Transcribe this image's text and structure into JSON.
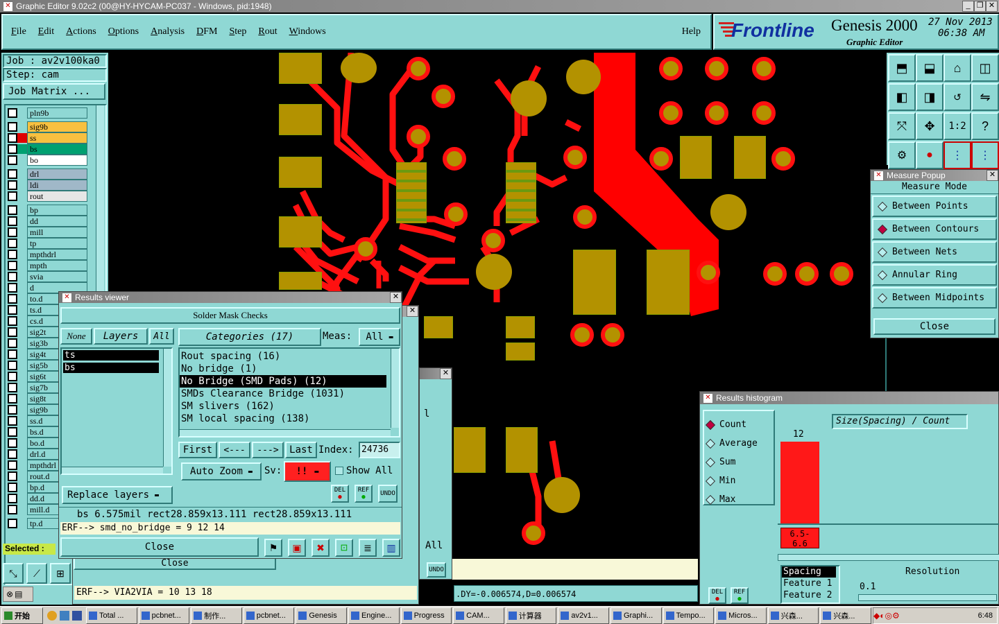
{
  "window": {
    "title": "Graphic Editor 9.02c2 (00@HY-HYCAM-PC037 - Windows, pid:1948)"
  },
  "menu": {
    "items": [
      "File",
      "Edit",
      "Actions",
      "Options",
      "Analysis",
      "DFM",
      "Step",
      "Rout",
      "Windows"
    ],
    "help": "Help"
  },
  "brand": {
    "logo": "Frontline",
    "product": "Genesis 2000",
    "sub": "Graphic Editor",
    "date": "27 Nov 2013",
    "time": "06:38 AM"
  },
  "job": {
    "job_label": "Job  : av2v100ka0",
    "step_label": "Step: cam",
    "matrix_button": "Job Matrix ..."
  },
  "layers": [
    {
      "name": "pln9b",
      "color": "#8fd8d4",
      "sw": "#8fd8d4"
    },
    {
      "name": "sig9b",
      "color": "#f7c040",
      "sw": "#8fd8d4"
    },
    {
      "name": "ss",
      "color": "#f7c040",
      "sw": "#e00000"
    },
    {
      "name": "bs",
      "color": "#00a070",
      "sw": "#00a070"
    },
    {
      "name": "bo",
      "color": "#ffffff",
      "sw": "#8fd8d4"
    },
    {
      "name": "drl",
      "color": "#a0b8c8",
      "sw": "#8fd8d4"
    },
    {
      "name": "ldi",
      "color": "#a0b8c8",
      "sw": "#8fd8d4"
    },
    {
      "name": "rout",
      "color": "#e6e6e6",
      "sw": "#8fd8d4"
    },
    {
      "name": "bp",
      "color": "#8fd8d4",
      "sw": "#8fd8d4"
    },
    {
      "name": "dd",
      "color": "#8fd8d4",
      "sw": "#8fd8d4"
    },
    {
      "name": "mill",
      "color": "#8fd8d4",
      "sw": "#8fd8d4"
    },
    {
      "name": "tp",
      "color": "#8fd8d4",
      "sw": "#8fd8d4"
    },
    {
      "name": "mpthdrl",
      "color": "#8fd8d4",
      "sw": "#8fd8d4"
    },
    {
      "name": "mpth",
      "color": "#8fd8d4",
      "sw": "#8fd8d4"
    },
    {
      "name": "svia",
      "color": "#8fd8d4",
      "sw": "#8fd8d4"
    },
    {
      "name": "d",
      "color": "#8fd8d4",
      "sw": "#8fd8d4"
    },
    {
      "name": "to.d",
      "color": "#8fd8d4",
      "sw": "#8fd8d4"
    },
    {
      "name": "ts.d",
      "color": "#8fd8d4",
      "sw": "#8fd8d4"
    },
    {
      "name": "cs.d",
      "color": "#8fd8d4",
      "sw": "#8fd8d4"
    },
    {
      "name": "sig2t",
      "color": "#8fd8d4",
      "sw": "#8fd8d4"
    },
    {
      "name": "sig3b",
      "color": "#8fd8d4",
      "sw": "#8fd8d4"
    },
    {
      "name": "sig4t",
      "color": "#8fd8d4",
      "sw": "#8fd8d4"
    },
    {
      "name": "sig5b",
      "color": "#8fd8d4",
      "sw": "#8fd8d4"
    },
    {
      "name": "sig6t",
      "color": "#8fd8d4",
      "sw": "#8fd8d4"
    },
    {
      "name": "sig7b",
      "color": "#8fd8d4",
      "sw": "#8fd8d4"
    },
    {
      "name": "sig8t",
      "color": "#8fd8d4",
      "sw": "#8fd8d4"
    },
    {
      "name": "sig9b",
      "color": "#8fd8d4",
      "sw": "#8fd8d4"
    },
    {
      "name": "ss.d",
      "color": "#8fd8d4",
      "sw": "#8fd8d4"
    },
    {
      "name": "bs.d",
      "color": "#8fd8d4",
      "sw": "#8fd8d4"
    },
    {
      "name": "bo.d",
      "color": "#8fd8d4",
      "sw": "#8fd8d4"
    },
    {
      "name": "drl.d",
      "color": "#8fd8d4",
      "sw": "#8fd8d4"
    },
    {
      "name": "mpthdrl",
      "color": "#8fd8d4",
      "sw": "#8fd8d4"
    },
    {
      "name": "rout.d",
      "color": "#8fd8d4",
      "sw": "#8fd8d4"
    },
    {
      "name": "bp.d",
      "color": "#8fd8d4",
      "sw": "#8fd8d4"
    },
    {
      "name": "dd.d",
      "color": "#8fd8d4",
      "sw": "#8fd8d4"
    },
    {
      "name": "mill.d",
      "color": "#8fd8d4",
      "sw": "#8fd8d4"
    },
    {
      "name": "tp.d",
      "color": "#8fd8d4",
      "sw": "#8fd8d4"
    }
  ],
  "selected_label": "Selected :",
  "results_viewer": {
    "title": "Results viewer",
    "heading": "Solder Mask Checks",
    "none_btn": "None",
    "layers_btn": "Layers",
    "all_btn": "All",
    "layer_list": [
      "ts",
      "bs"
    ],
    "categories_btn": "Categories (17)",
    "meas_label": "Meas:",
    "meas_value": "All",
    "categories": [
      "Rout spacing (16)",
      "No bridge (1)",
      "No Bridge (SMD Pads) (12)",
      "SMDs Clearance Bridge (1031)",
      "SM slivers (162)",
      "SM local spacing (138)"
    ],
    "selected_category": 2,
    "first_btn": "First",
    "prev_btn": "<---",
    "next_btn": "--->",
    "last_btn": "Last",
    "index_label": "Index:",
    "index_value": "24736",
    "auto_zoom": "Auto Zoom",
    "sv_label": "Sv:",
    "sv_value": "!!",
    "show_all": "Show All",
    "replace_layers": "Replace layers",
    "del": "DEL",
    "ref": "REF",
    "undo": "UNDO",
    "info_line": "bs 6.575mil  rect28.859x13.111  rect28.859x13.111",
    "erf_line": "ERF--> smd_no_bridge = 9 12 14",
    "close": "Close"
  },
  "back_window": {
    "partial_1": "l",
    "partial_2": "l",
    "partial_all": "All",
    "close": "Close",
    "erf_line": "ERF--> VIA2VIA = 10 13 18"
  },
  "coords": ".DY=-0.006574,D=0.006574",
  "measure_popup": {
    "title": "Measure Popup",
    "heading": "Measure Mode",
    "options": [
      "Between Points",
      "Between Contours",
      "Between Nets",
      "Annular Ring",
      "Between Midpoints"
    ],
    "selected": 1,
    "close": "Close"
  },
  "histogram": {
    "title": "Results histogram",
    "modes": [
      "Count",
      "Average",
      "Sum",
      "Min",
      "Max"
    ],
    "selected": 0,
    "axis_title": "Size(Spacing) / Count",
    "bar_count": 12,
    "bar_range": "6.5- 6.6",
    "resolution_label": "Resolution",
    "resolution_value": "0.1",
    "list": [
      "Spacing",
      "Feature 1",
      "Feature 2"
    ],
    "del": "DEL",
    "ref": "REF"
  },
  "taskbar": {
    "start": "开始",
    "items": [
      "Total ...",
      "pcbnet...",
      "制作...",
      "pcbnet...",
      "Genesis",
      "Engine...",
      "Progress",
      "CAM...",
      "计算器",
      "av2v1...",
      "Graphi...",
      "Tempo...",
      "Micros...",
      "兴森...",
      "兴森..."
    ],
    "clock": "6:48"
  }
}
